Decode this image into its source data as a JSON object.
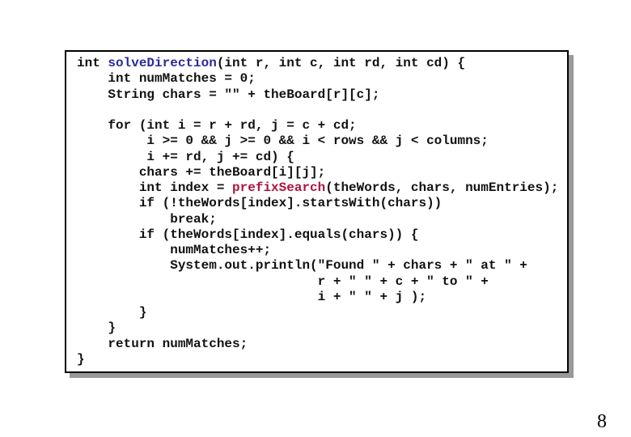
{
  "colors": {
    "method_name": "#2b2b9a",
    "call_name": "#b0143c",
    "text": "#111111"
  },
  "code_lines": [
    [
      {
        "t": "int "
      },
      {
        "t": "solveDirection",
        "c": "method_name"
      },
      {
        "t": "(int r, int c, int rd, int cd) {"
      }
    ],
    [
      {
        "t": "    int numMatches = 0;"
      }
    ],
    [
      {
        "t": "    String chars = \"\" + theBoard[r][c];"
      }
    ],
    [
      {
        "t": ""
      }
    ],
    [
      {
        "t": "    for (int i = r + rd, j = c + cd;"
      }
    ],
    [
      {
        "t": "         i >= 0 && j >= 0 && i < rows && j < columns;"
      }
    ],
    [
      {
        "t": "         i += rd, j += cd) {"
      }
    ],
    [
      {
        "t": "        chars += theBoard[i][j];"
      }
    ],
    [
      {
        "t": "        int index = "
      },
      {
        "t": "prefixSearch",
        "c": "call_name"
      },
      {
        "t": "(theWords, chars, numEntries);"
      }
    ],
    [
      {
        "t": "        if (!theWords[index].startsWith(chars))"
      }
    ],
    [
      {
        "t": "            break;"
      }
    ],
    [
      {
        "t": "        if (theWords[index].equals(chars)) {"
      }
    ],
    [
      {
        "t": "            numMatches++;"
      }
    ],
    [
      {
        "t": "            System.out.println(\"Found \" + chars + \" at \" +"
      }
    ],
    [
      {
        "t": "                               r + \" \" + c + \" to \" +"
      }
    ],
    [
      {
        "t": "                               i + \" \" + j );"
      }
    ],
    [
      {
        "t": "        }"
      }
    ],
    [
      {
        "t": "    }"
      }
    ],
    [
      {
        "t": "    return numMatches;"
      }
    ],
    [
      {
        "t": "}"
      }
    ]
  ],
  "page_number": "8"
}
